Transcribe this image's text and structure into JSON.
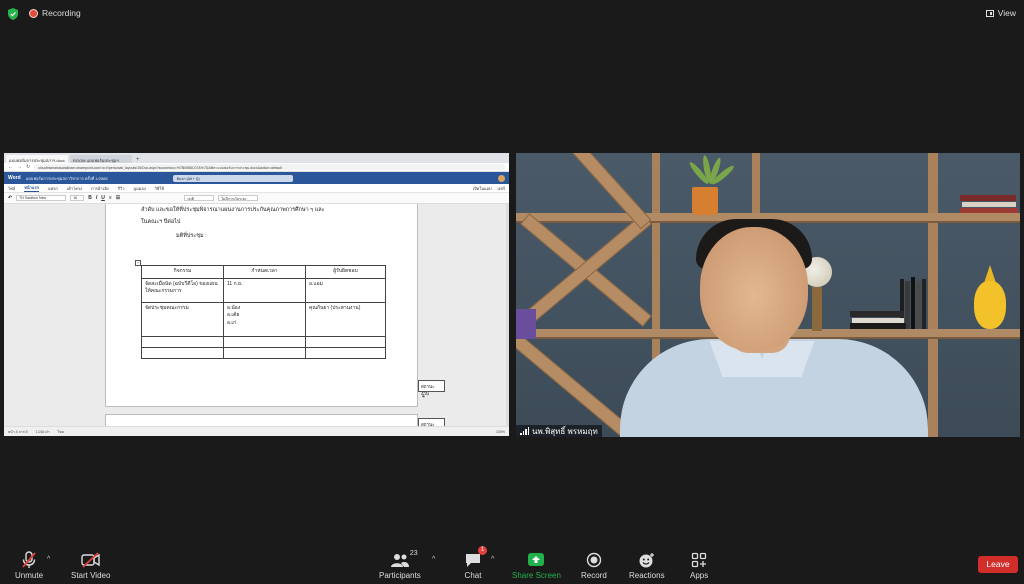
{
  "topbar": {
    "recording_label": "Recording",
    "view_label": "View",
    "colors": {
      "recording_dot": "#e04a3f",
      "shield": "#27b24a"
    }
  },
  "shared_screen": {
    "browser_tabs": [
      "แบบฟอร์มการประชุมสภาฯ.docx",
      "ROOM แบบฟอร์มประชุมฯ"
    ],
    "url": "cloudmsmahasarakham.sharepoint.com/:w:/r/personal/_layouts/15/Doc.aspx?sourcedoc=%7B0985C07A%7D&file=แบบฟอร์มการประชุม.docx&action=default",
    "word_app": "Word",
    "doc_name": "แบบฟอร์มการประชุมสภาวิชาการ ครั้งที่ 1/2565",
    "search_placeholder": "ค้นหา (Alt + Q)",
    "menu": [
      "ไฟล์",
      "หน้าแรก",
      "แทรก",
      "เค้าโครง",
      "การอ้างอิง",
      "รีวิว",
      "มุมมอง",
      "วิธีใช้"
    ],
    "menu_right": [
      "เปิดในแอป",
      "แชร์"
    ],
    "ribbon": {
      "font": "TH Sarabun New",
      "size": "16",
      "style": "ปกติ",
      "style2": "ไม่มีการเว้นระยะ"
    },
    "doc": {
      "line1": "ลำดับ และขอให้ที่ประชุมพิจารณาแผนงานการประกันคุณภาพการศึกษา ๆ และ",
      "line2": "ในคณะฯ ปีต่อไป",
      "line3": "มติที่ประชุม :",
      "table": {
        "headers": [
          "กิจกรรม",
          "กำหนดเวลา",
          "ผู้รับผิดชอบ"
        ],
        "rows": [
          [
            "จัดสะเมื่อนัด (ฉบับวีดีโอ) ของแผนให้คณะกรรมการ",
            "11 ก.ย.",
            "อ.แอม"
          ],
          [
            "จัดประชุมคณะกรรม",
            "อ.น้อง\nอ.เต้ย\nอ.เก่",
            "คุณกันยา (ประสานงาน)"
          ],
          [
            "",
            "",
            ""
          ],
          [
            "",
            "",
            ""
          ]
        ]
      },
      "side_note": "สถานะงาน",
      "side_num": "4",
      "side_note2": "สถานะงาน"
    },
    "status": {
      "page": "หน้า 4 จาก 5",
      "words": "1,016 คำ",
      "lang": "ไทย",
      "zoom": "100%"
    }
  },
  "video": {
    "participant_name": "นพ.พิสุทธิ์ พรหมฤท",
    "colors": {
      "shirt": "#c4d3e2",
      "wall": "#4a5a68"
    }
  },
  "toolbar": {
    "unmute": "Unmute",
    "start_video": "Start Video",
    "participants": "Participants",
    "participants_count": "23",
    "chat": "Chat",
    "chat_badge": "1",
    "share_screen": "Share Screen",
    "record": "Record",
    "reactions": "Reactions",
    "apps": "Apps",
    "leave": "Leave",
    "colors": {
      "share": "#22b14c",
      "leave": "#d12e2a",
      "muted": "#e3403a"
    }
  }
}
